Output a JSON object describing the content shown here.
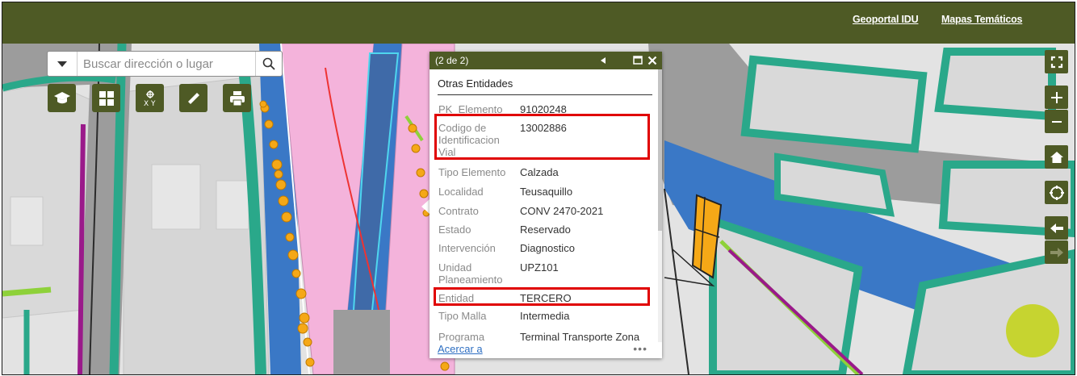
{
  "header": {
    "links": [
      {
        "label": "Geoportal IDU"
      },
      {
        "label": "Mapas Temáticos"
      }
    ]
  },
  "search": {
    "placeholder": "Buscar dirección o lugar",
    "value": ""
  },
  "toolbar": {
    "tools": [
      "graduation-cap-icon",
      "grid-icon",
      "xy-coordinates-icon",
      "ruler-icon",
      "printer-icon"
    ]
  },
  "map_controls": [
    "fullscreen-icon",
    "zoom-in-icon",
    "zoom-out-icon",
    "home-icon",
    "locate-icon",
    "back-arrow-icon",
    "forward-arrow-icon"
  ],
  "popup": {
    "counter": "(2 de 2)",
    "layer_title": "Otras Entidades",
    "fields": [
      {
        "label": "PK_Elemento",
        "value": "91020248"
      },
      {
        "label": "Codigo de Identificacion Vial",
        "value": "13002886"
      },
      {
        "label": "Tipo Elemento",
        "value": "Calzada"
      },
      {
        "label": "Localidad",
        "value": "Teusaquillo"
      },
      {
        "label": "Contrato",
        "value": "CONV 2470-2021"
      },
      {
        "label": "Estado",
        "value": "Reservado"
      },
      {
        "label": "Intervención",
        "value": "Diagnostico"
      },
      {
        "label": "Unidad Planeamiento",
        "value": "UPZ101"
      },
      {
        "label": "Entidad",
        "value": "TERCERO"
      },
      {
        "label": "Tipo Malla",
        "value": "Intermedia"
      },
      {
        "label": "Programa",
        "value": "Terminal Transporte Zona"
      }
    ],
    "zoom_link": "Acercar a",
    "more": "•••"
  },
  "colors": {
    "header": "#4e5a25",
    "highlight": "#e00000",
    "link": "#2e6fc2",
    "road_blue": "#3a78c6",
    "road_pink": "#f4b3db",
    "green_strip": "#2aa88a",
    "lime": "#8ed13a",
    "orange": "#f5a817",
    "accent_dot": "#c6d430"
  }
}
